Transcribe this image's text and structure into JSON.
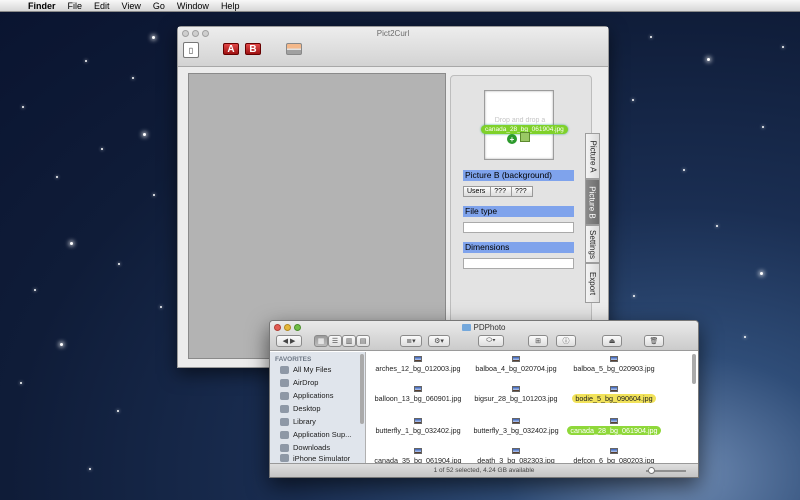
{
  "menubar": {
    "apple": "",
    "items": [
      "Finder",
      "File",
      "Edit",
      "View",
      "Go",
      "Window",
      "Help"
    ]
  },
  "pict2curl": {
    "title": "Pict2Curl",
    "toolbar": {
      "doc_glyph": "▯",
      "a_label": "A",
      "b_label": "B"
    },
    "drop_hint": "Drop and drop a",
    "drag_filename": "canada_28_bg_061904.jpg",
    "drag_plus": "+",
    "picture_b_label": "Picture B (background)",
    "path_segments": [
      "Users",
      "???",
      "???"
    ],
    "file_type_label": "File type",
    "dimensions_label": "Dimensions",
    "tabs": [
      "Picture A",
      "Picture B",
      "Settings",
      "Export"
    ],
    "active_tab": "Picture B"
  },
  "finder": {
    "title": "PDPhoto",
    "sidebar_heading": "FAVORITES",
    "sidebar_items": [
      "All My Files",
      "AirDrop",
      "Applications",
      "Desktop",
      "Library",
      "Application Sup...",
      "Downloads",
      "iPhone Simulator"
    ],
    "files": [
      [
        "arches_12_bg_012003.jpg",
        "balboa_4_bg_020704.jpg",
        "balboa_5_bg_020903.jpg"
      ],
      [
        "balloon_13_bg_060901.jpg",
        "bigsur_28_bg_101203.jpg",
        "bodie_5_bg_090604.jpg"
      ],
      [
        "butterfly_1_bg_032402.jpg",
        "butterfly_3_bg_032402.jpg",
        "canada_28_bg_061904.jpg"
      ],
      [
        "canada_35_bg_061904.jpg",
        "death_3_bg_082303.jpg",
        "defcon_6_bg_080203.jpg"
      ]
    ],
    "status": "1 of 52 selected, 4.24 GB available"
  },
  "colors": {
    "selection_blue": "#7fa3ec",
    "finder_label_yellow": "#f1e25a",
    "drag_green": "#7fd12a"
  }
}
